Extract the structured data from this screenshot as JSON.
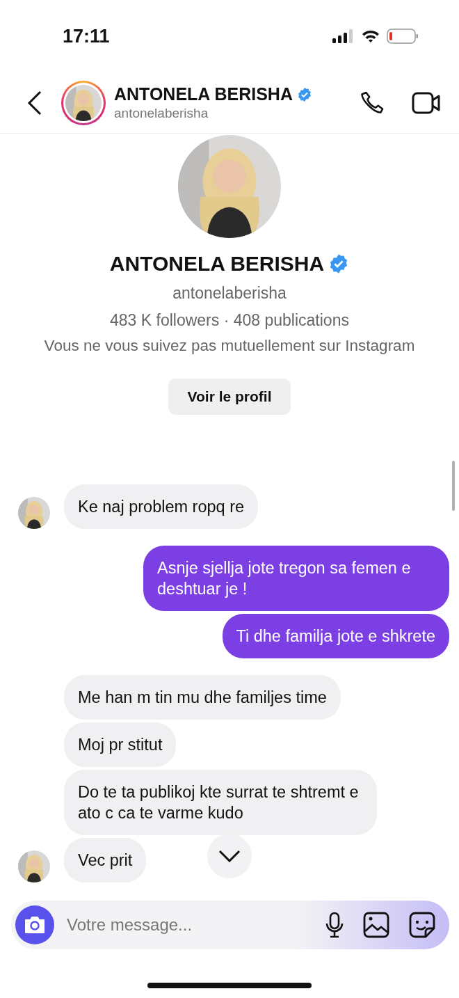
{
  "status_bar": {
    "time": "17:11"
  },
  "header": {
    "name": "ANTONELA BERISHA",
    "username": "antonelaberisha",
    "verified": true
  },
  "profile": {
    "name": "ANTONELA BERISHA",
    "verified": true,
    "username": "antonelaberisha",
    "stats": "483 K followers · 408 publications",
    "note": "Vous ne vous suivez pas mutuellement sur Instagram",
    "button": "Voir le profil"
  },
  "messages": [
    {
      "kind": "incoming",
      "text": "Ke naj problem ropq re",
      "show_avatar": true
    },
    {
      "kind": "outgoing",
      "text": "Asnje sjellja jote tregon sa femen e deshtuar je !"
    },
    {
      "kind": "outgoing",
      "text": "Ti dhe familja jote e shkrete"
    },
    {
      "kind": "incoming",
      "text": "Me han m tin mu dhe familjes time",
      "show_avatar": false
    },
    {
      "kind": "incoming",
      "text": "Moj pr stitut",
      "show_avatar": false
    },
    {
      "kind": "incoming",
      "text": "Do te ta publikoj kte surrat te shtremt e ato c ca te varme kudo",
      "show_avatar": false
    },
    {
      "kind": "incoming",
      "text": "Vec prit",
      "show_avatar": true
    }
  ],
  "composer": {
    "placeholder": "Votre message..."
  }
}
